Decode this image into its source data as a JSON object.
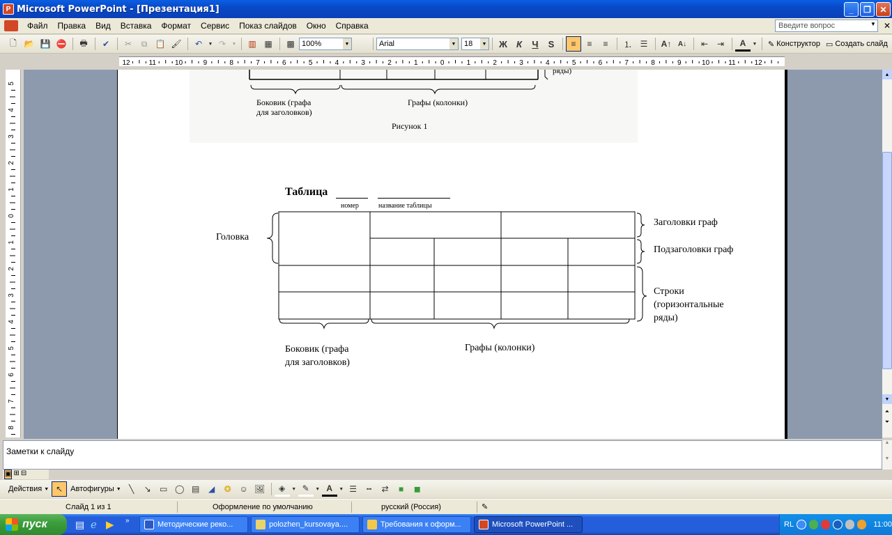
{
  "window": {
    "title": "Microsoft PowerPoint - [Презентация1]",
    "app_icon": "P"
  },
  "menu": {
    "items": [
      "Файл",
      "Правка",
      "Вид",
      "Вставка",
      "Формат",
      "Сервис",
      "Показ слайдов",
      "Окно",
      "Справка"
    ],
    "ask_placeholder": "Введите вопрос"
  },
  "toolbar": {
    "zoom": "100%",
    "font": "Arial",
    "font_size": "18",
    "bold": "Ж",
    "italic": "К",
    "underline": "Ч",
    "shadow": "S",
    "designer": "Конструктор",
    "new_slide": "Создать слайд"
  },
  "ruler": {
    "h_labels": [
      "12",
      "11",
      "10",
      "9",
      "8",
      "7",
      "6",
      "5",
      "4",
      "3",
      "2",
      "1",
      "0",
      "1",
      "2",
      "3",
      "4",
      "5",
      "6",
      "7",
      "8",
      "9",
      "10",
      "11",
      "12"
    ],
    "v_labels": [
      "5",
      "4",
      "3",
      "2",
      "1",
      "0",
      "1",
      "2",
      "3",
      "4",
      "5",
      "6",
      "7",
      "8"
    ]
  },
  "slide": {
    "top_figure": {
      "left_label": "Боковик (графа\nдля заголовков)",
      "right_label": "Графы (колонки)",
      "caption": "Рисунок 1",
      "clipped_text": "ряды)"
    },
    "table_title": "Таблица",
    "number_label": "номер",
    "name_label": "название таблицы",
    "head_label": "Головка",
    "col_headers_label": "Заголовки граф",
    "sub_headers_label": "Подзаголовки граф",
    "rows_label": "Строки\n(горизонтальные\nряды)",
    "stub_label": "Боковик (графа\nдля заголовков)",
    "columns_label": "Графы (колонки)"
  },
  "notes": {
    "placeholder": "Заметки к слайду"
  },
  "drawbar": {
    "actions": "Действия",
    "autoshapes": "Автофигуры"
  },
  "status": {
    "slide": "Слайд 1 из 1",
    "design": "Оформление по умолчанию",
    "lang": "русский (Россия)"
  },
  "taskbar": {
    "start": "пуск",
    "tasks": [
      "Методические реко...",
      "polozhen_kursovaya....",
      "Требования к оформ...",
      "Microsoft PowerPoint ..."
    ],
    "lang": "RL",
    "clock": "11:00"
  }
}
